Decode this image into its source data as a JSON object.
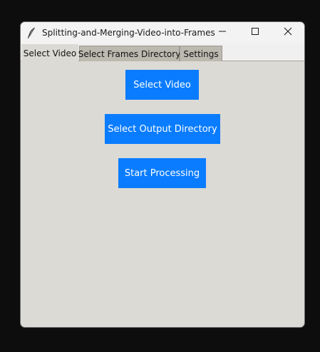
{
  "window": {
    "title": "Splitting-and-Merging-Video-into-Frames",
    "app_icon": "feather-icon",
    "controls": [
      "minimize-icon",
      "maximize-icon",
      "close-icon"
    ]
  },
  "tabs": [
    {
      "label": "Select Video",
      "active": true
    },
    {
      "label": "Select Frames Directory",
      "active": false
    },
    {
      "label": "Settings",
      "active": false
    }
  ],
  "buttons": {
    "select_video": "Select Video",
    "select_output_directory": "Select Output Directory",
    "start_processing": "Start Processing"
  },
  "colors": {
    "button_bg": "#0a7cff",
    "button_text": "#ffffff",
    "window_bg": "#dcdad5",
    "titlebar_bg": "#f3f3f3",
    "inactive_tab": "#bcb9b0"
  }
}
